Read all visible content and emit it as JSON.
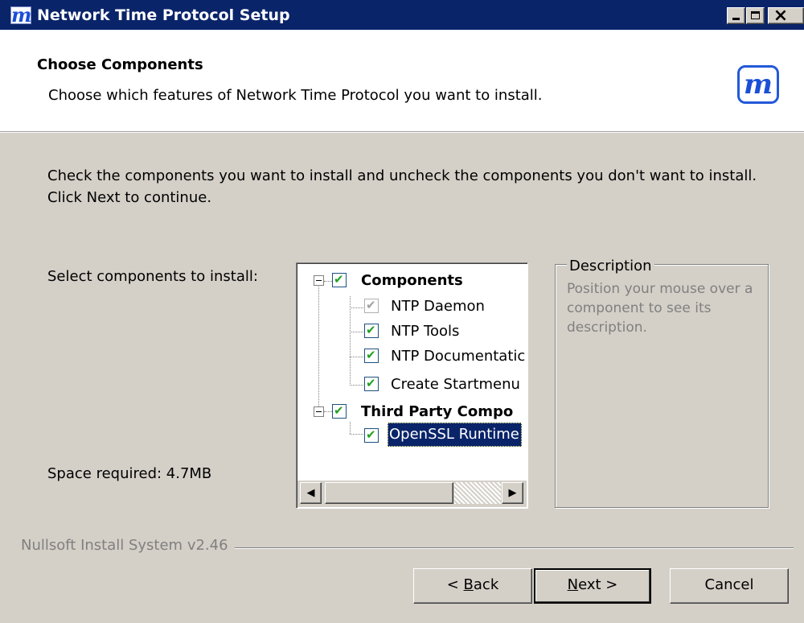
{
  "window": {
    "title": "Network Time Protocol Setup",
    "icon_glyph": "m",
    "controls": {
      "minimize": "minimize-icon",
      "maximize": "maximize-icon",
      "close": "×"
    }
  },
  "header": {
    "title": "Choose Components",
    "subtitle": "Choose which features of Network Time Protocol you want to install.",
    "logo_glyph": "m"
  },
  "body": {
    "intro": "Check the components you want to install and uncheck the components you don't want to install. Click Next to continue.",
    "select_label": "Select components to install:",
    "space_label": "Space required: 4.7MB"
  },
  "tree": {
    "items": [
      {
        "label": "Components",
        "checked": true,
        "bold": true,
        "expandable": true
      },
      {
        "label": "NTP Daemon",
        "checked": true,
        "disabled": true
      },
      {
        "label": "NTP Tools",
        "checked": true
      },
      {
        "label": "NTP Documentatic",
        "checked": true
      },
      {
        "label": "Create Startmenu",
        "checked": true
      },
      {
        "label": "Third Party Compo",
        "checked": true,
        "bold": true,
        "expandable": true
      },
      {
        "label": "OpenSSL Runtime",
        "checked": true,
        "selected": true
      }
    ],
    "scroll_left": "◀",
    "scroll_right": "▶"
  },
  "description": {
    "legend": "Description",
    "text": "Position your mouse over a component to see its description."
  },
  "footer": {
    "branding": "Nullsoft Install System v2.46",
    "back": {
      "prefix": "< ",
      "mnemonic": "B",
      "rest": "ack"
    },
    "next": {
      "mnemonic": "N",
      "rest": "ext >"
    },
    "cancel": "Cancel"
  },
  "colors": {
    "titlebar": "#0a246a",
    "dialog_bg": "#d4d0c8",
    "check": "#21a121",
    "selection": "#0a246a",
    "logo": "#1a4fd6"
  }
}
